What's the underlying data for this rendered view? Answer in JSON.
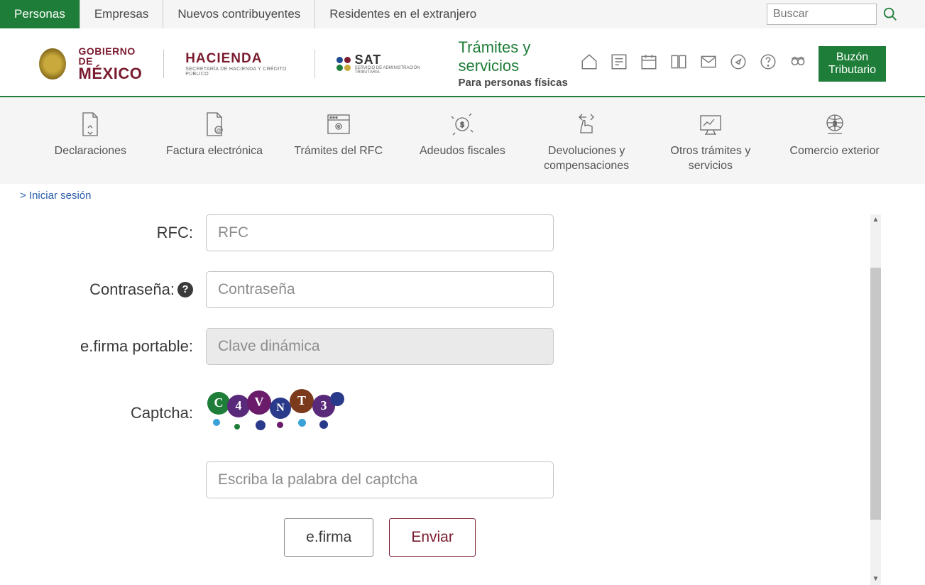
{
  "topbar": {
    "tabs": [
      "Personas",
      "Empresas",
      "Nuevos contribuyentes",
      "Residentes en el extranjero"
    ],
    "active_index": 0,
    "search_placeholder": "Buscar"
  },
  "logos": {
    "gobierno_line1": "GOBIERNO DE",
    "gobierno_line2": "MÉXICO",
    "hacienda_line1": "HACIENDA",
    "hacienda_line2": "SECRETARÍA DE HACIENDA Y CRÉDITO PÚBLICO",
    "sat_line1": "SAT",
    "sat_line2": "SERVICIO DE ADMINISTRACIÓN TRIBUTARIA"
  },
  "header": {
    "title": "Trámites y servicios",
    "subtitle": "Para personas físicas",
    "buzon_label": "Buzón Tributario",
    "icons": [
      "home-icon",
      "news-icon",
      "calendar-icon",
      "book-icon",
      "mail-icon",
      "compass-icon",
      "help-icon",
      "owl-icon"
    ]
  },
  "categories": [
    {
      "label": "Declaraciones",
      "icon": "document-up-icon"
    },
    {
      "label": "Factura electrónica",
      "icon": "invoice-icon"
    },
    {
      "label": "Trámites del RFC",
      "icon": "browser-gear-icon"
    },
    {
      "label": "Adeudos fiscales",
      "icon": "money-down-icon"
    },
    {
      "label": "Devoluciones y compensaciones",
      "icon": "hand-swap-icon"
    },
    {
      "label": "Otros trámites y servicios",
      "icon": "chart-screen-icon"
    },
    {
      "label": "Comercio exterior",
      "icon": "globe-dollar-icon"
    }
  ],
  "breadcrumb": "> Iniciar sesión",
  "form": {
    "rfc_label": "RFC:",
    "rfc_placeholder": "RFC",
    "password_label": "Contraseña:",
    "password_placeholder": "Contraseña",
    "efirma_portable_label": "e.firma portable:",
    "efirma_portable_placeholder": "Clave dinámica",
    "captcha_label": "Captcha:",
    "captcha_text": "C4VNT3",
    "captcha_input_placeholder": "Escriba la palabra del captcha",
    "efirma_button": "e.firma",
    "submit_button": "Enviar"
  },
  "colors": {
    "green": "#1e7d38",
    "maroon": "#7a1b2e",
    "link": "#2a5da8"
  }
}
